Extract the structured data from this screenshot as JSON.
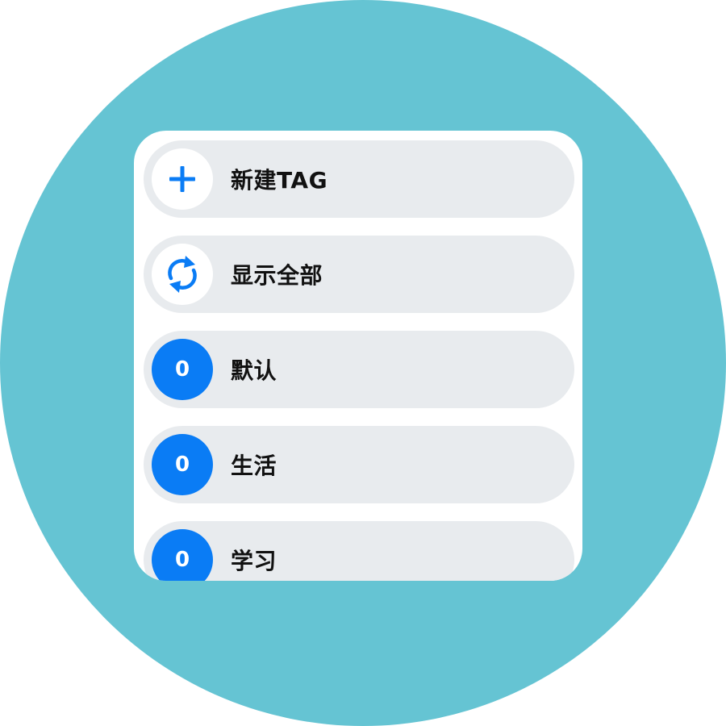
{
  "colors": {
    "background": "#65c4d3",
    "screen": "#ffffff",
    "row": "#e8ebee",
    "accent": "#0a7cf5",
    "text": "#111111"
  },
  "menu": {
    "new_tag": {
      "icon": "plus-icon",
      "label": "新建TAG"
    },
    "show_all": {
      "icon": "refresh-icon",
      "label": "显示全部"
    },
    "tags": [
      {
        "count": "0",
        "label": "默认"
      },
      {
        "count": "0",
        "label": "生活"
      },
      {
        "count": "0",
        "label": "学习"
      }
    ]
  }
}
